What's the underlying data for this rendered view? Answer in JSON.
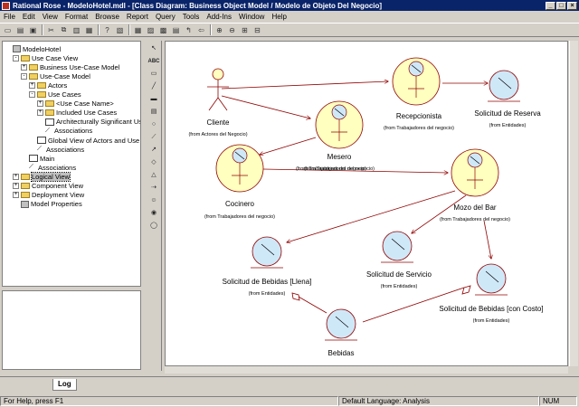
{
  "window": {
    "title": "Rational Rose - ModeloHotel.mdl - [Class Diagram: Business Object Model / Modelo de Objeto Del Negocio]"
  },
  "menu": [
    "File",
    "Edit",
    "View",
    "Format",
    "Browse",
    "Report",
    "Query",
    "Tools",
    "Add-Ins",
    "Window",
    "Help"
  ],
  "toolbar_icons": [
    "new-icon",
    "open-icon",
    "save-icon",
    "cut-icon",
    "copy-icon",
    "paste-icon",
    "print-icon",
    "context-help-icon",
    "view-doc-icon",
    "browse-class-icon",
    "browse-interaction-icon",
    "browse-component-icon",
    "browse-deployment-icon",
    "browse-parent-icon",
    "browse-previous-icon",
    "zoom-in-icon",
    "zoom-out-icon",
    "fit-window-icon",
    "undo-fit-icon"
  ],
  "tree": [
    {
      "label": "ModeloHotel",
      "level": 0,
      "icon": "pkg",
      "exp": ""
    },
    {
      "label": "Use Case View",
      "level": 1,
      "icon": "folder",
      "exp": "-"
    },
    {
      "label": "Business Use-Case Model",
      "level": 2,
      "icon": "folder",
      "exp": "+"
    },
    {
      "label": "Use-Case Model",
      "level": 2,
      "icon": "folder",
      "exp": "-"
    },
    {
      "label": "Actors",
      "level": 3,
      "icon": "folder",
      "exp": "+"
    },
    {
      "label": "Use Cases",
      "level": 3,
      "icon": "folder",
      "exp": "-"
    },
    {
      "label": "<Use Case Name>",
      "level": 4,
      "icon": "folder",
      "exp": "+"
    },
    {
      "label": "Included Use Cases",
      "level": 4,
      "icon": "folder",
      "exp": "+"
    },
    {
      "label": "Architecturally Significant Us",
      "level": 4,
      "icon": "diag",
      "exp": ""
    },
    {
      "label": "Associations",
      "level": 4,
      "icon": "assoc",
      "exp": ""
    },
    {
      "label": "Global View of Actors and Use C",
      "level": 3,
      "icon": "diag",
      "exp": ""
    },
    {
      "label": "Associations",
      "level": 3,
      "icon": "assoc",
      "exp": ""
    },
    {
      "label": "Main",
      "level": 2,
      "icon": "diag",
      "exp": ""
    },
    {
      "label": "Associations",
      "level": 2,
      "icon": "assoc",
      "exp": ""
    },
    {
      "label": "Logical View",
      "level": 1,
      "icon": "folder",
      "exp": "+",
      "selected": true
    },
    {
      "label": "Component View",
      "level": 1,
      "icon": "folder",
      "exp": "+"
    },
    {
      "label": "Deployment View",
      "level": 1,
      "icon": "folder",
      "exp": "+"
    },
    {
      "label": "Model Properties",
      "level": 1,
      "icon": "pkg",
      "exp": ""
    }
  ],
  "palette": [
    "select-icon",
    "ABC",
    "note-icon",
    "anchor-icon",
    "package-icon",
    "class-icon",
    "interface-icon",
    "association-icon",
    "unidirectional-icon",
    "aggregation-icon",
    "generalization-icon",
    "realize-icon",
    "business-actor-icon",
    "business-worker-icon",
    "business-entity-icon"
  ],
  "diagram": {
    "actors": [
      {
        "name": "Cliente",
        "from": "(from Actores del Negocio)"
      }
    ],
    "workers": [
      {
        "name": "Recepcionista",
        "from": "(from Trabajadores del negocio)"
      },
      {
        "name": "Mesero",
        "from": "(from Trabajadores del negocio)"
      },
      {
        "name": "Cocinero",
        "from": "(from Trabajadores del negocio)"
      },
      {
        "name": "Mozo del Bar",
        "from": "(from Trabajadores del negocio)"
      }
    ],
    "entities": [
      {
        "name": "Solicitud de Reserva",
        "from": "(from Entidades)"
      },
      {
        "name": "Solicitud de Bebidas [Llena]",
        "from": "(from Entidades)"
      },
      {
        "name": "Solicitud de Servicio",
        "from": "(from Entidades)"
      },
      {
        "name": "Solicitud de Bebidas [con Costo]",
        "from": "(from Entidades)"
      },
      {
        "name": "Bebidas",
        "from": ""
      }
    ],
    "links": [
      {
        "from": "Cliente",
        "to": "Recepcionista",
        "label": ""
      },
      {
        "from": "Cliente",
        "to": "Mesero",
        "label": ""
      },
      {
        "from": "Recepcionista",
        "to": "Solicitud de Reserva",
        "label": ""
      },
      {
        "from": "Mesero",
        "to": "Cocinero",
        "label": ""
      },
      {
        "from": "Cocinero",
        "to": "Mozo del Bar",
        "label": "(from Trabajadores del negocio)"
      },
      {
        "from": "Mozo del Bar",
        "to": "Solicitud de Bebidas [Llena]",
        "label": ""
      },
      {
        "from": "Mozo del Bar",
        "to": "Solicitud de Servicio",
        "label": ""
      },
      {
        "from": "Mozo del Bar",
        "to": "Solicitud de Bebidas [con Costo]",
        "label": ""
      },
      {
        "from": "Bebidas",
        "to": "Solicitud de Bebidas [Llena]",
        "label": ""
      },
      {
        "from": "Bebidas",
        "to": "Solicitud de Bebidas [con Costo]",
        "label": ""
      }
    ]
  },
  "log_tab": "Log",
  "status": {
    "help": "For Help, press F1",
    "language": "Default Language: Analysis",
    "num": "NUM"
  },
  "colors": {
    "titlebar": "#0a246a",
    "worker_fill": "#ffffc0",
    "entity_fill": "#cfe8f8",
    "stroke": "#900000"
  }
}
